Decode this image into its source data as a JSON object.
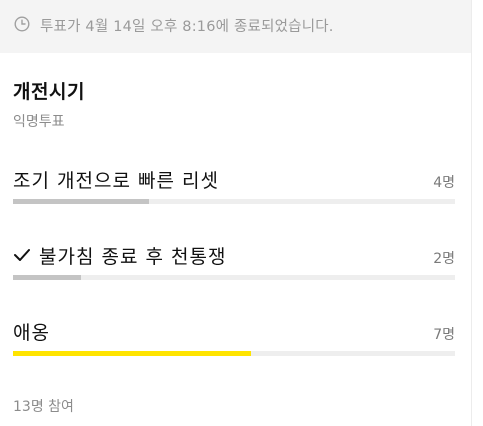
{
  "notice": {
    "icon": "clock-icon",
    "text": "투표가 4월 14일 오후 8:16에 종료되었습니다."
  },
  "poll": {
    "title": "개전시기",
    "subtitle": "익명투표",
    "options": [
      {
        "label": "조기 개전으로 빠른 리셋",
        "count": "4명",
        "votes": 4,
        "fraction": 0.308,
        "selected": false,
        "leading": false
      },
      {
        "label": "불가침 종료 후 천통쟁",
        "count": "2명",
        "votes": 2,
        "fraction": 0.154,
        "selected": true,
        "selected_icon": "check-icon",
        "leading": false
      },
      {
        "label": "애옹",
        "count": "7명",
        "votes": 7,
        "fraction": 0.538,
        "selected": false,
        "leading": true
      }
    ],
    "participants": "13명 참여"
  },
  "colors": {
    "notice_bg": "#f4f4f4",
    "bar_track": "#eeeeee",
    "bar_fill": "#c4c4c4",
    "bar_fill_leading": "#ffe400"
  }
}
